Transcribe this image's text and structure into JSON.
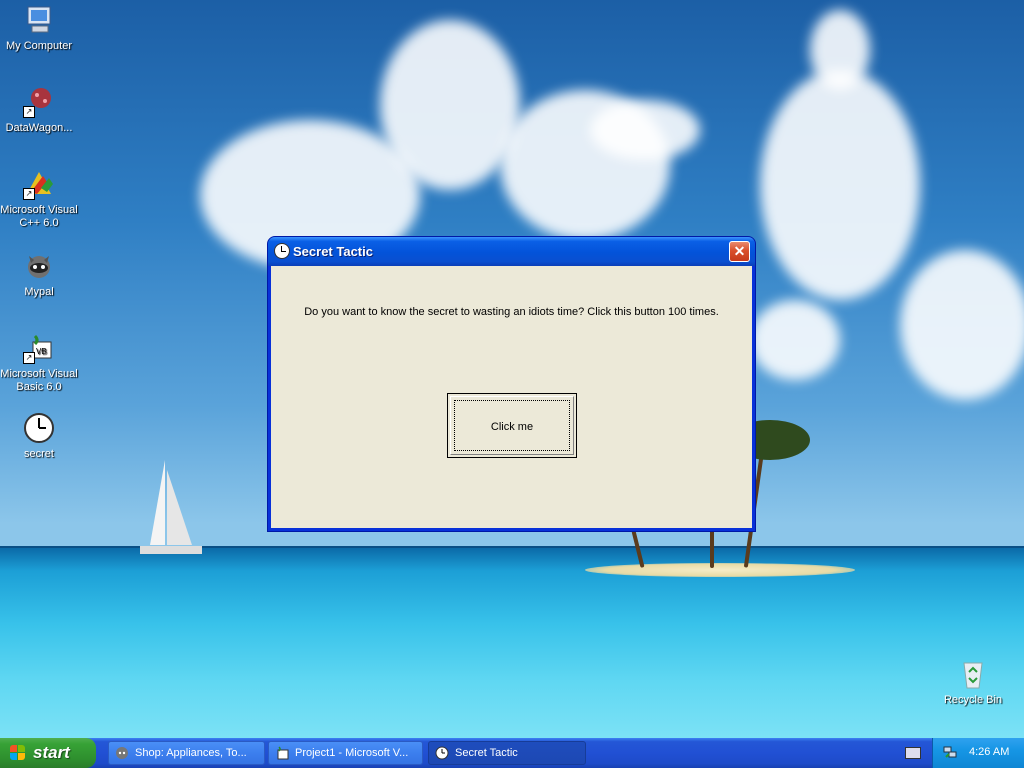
{
  "desktop": {
    "icons": [
      {
        "label": "My Computer",
        "icon": "my-computer-icon"
      },
      {
        "label": "DataWagon...",
        "icon": "datawagon-icon"
      },
      {
        "label": "Microsoft Visual C++ 6.0",
        "icon": "visual-cpp-icon"
      },
      {
        "label": "Mypal",
        "icon": "mypal-icon"
      },
      {
        "label": "Microsoft Visual Basic 6.0",
        "icon": "visual-basic-icon"
      },
      {
        "label": "secret",
        "icon": "clock-icon"
      },
      {
        "label": "Recycle Bin",
        "icon": "recycle-bin-icon"
      }
    ]
  },
  "dialog": {
    "title": "Secret Tactic",
    "close_symbol": "✕",
    "message": "Do you want to know the secret to wasting an idiots time? Click this button 100 times.",
    "button_label": "Click me"
  },
  "taskbar": {
    "start_label": "start",
    "tasks": [
      {
        "label": "Shop: Appliances, To...",
        "icon": "mypal-icon",
        "active": false
      },
      {
        "label": "Project1 - Microsoft V...",
        "icon": "visual-basic-icon",
        "active": false
      },
      {
        "label": "Secret Tactic",
        "icon": "clock-icon",
        "active": true
      }
    ],
    "clock": "4:26 AM"
  }
}
